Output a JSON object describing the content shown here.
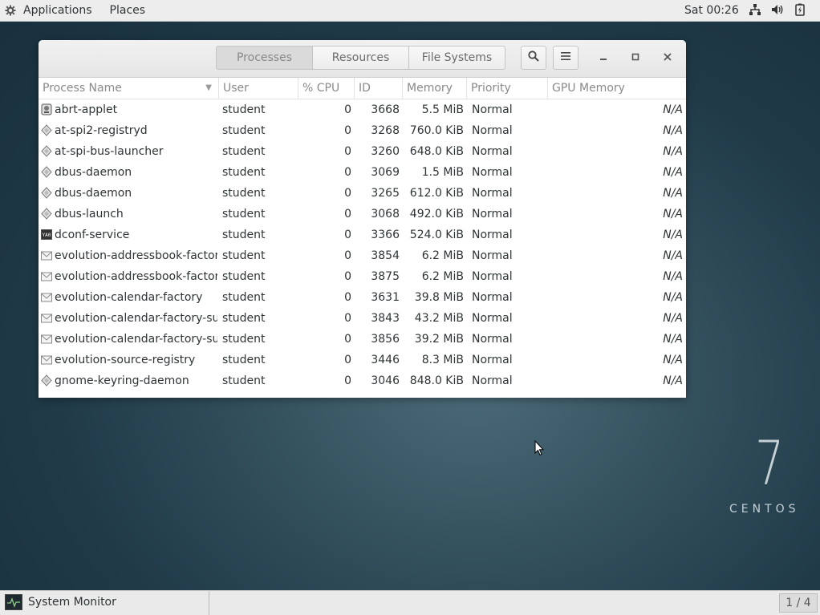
{
  "topbar": {
    "applications_label": "Applications",
    "places_label": "Places",
    "clock": "Sat 00:26"
  },
  "window": {
    "tabs": [
      "Processes",
      "Resources",
      "File Systems"
    ],
    "active_tab": "Processes",
    "columns": {
      "name": "Process Name",
      "user": "User",
      "cpu": "% CPU",
      "id": "ID",
      "memory": "Memory",
      "priority": "Priority",
      "gpu": "GPU Memory"
    },
    "rows": [
      {
        "icon": "applet-icon",
        "name": "abrt-applet",
        "user": "student",
        "cpu": "0",
        "id": "3668",
        "memory": "5.5 MiB",
        "priority": "Normal",
        "gpu": "N/A"
      },
      {
        "icon": "generic-process-icon",
        "name": "at-spi2-registryd",
        "user": "student",
        "cpu": "0",
        "id": "3268",
        "memory": "760.0 KiB",
        "priority": "Normal",
        "gpu": "N/A"
      },
      {
        "icon": "generic-process-icon",
        "name": "at-spi-bus-launcher",
        "user": "student",
        "cpu": "0",
        "id": "3260",
        "memory": "648.0 KiB",
        "priority": "Normal",
        "gpu": "N/A"
      },
      {
        "icon": "generic-process-icon",
        "name": "dbus-daemon",
        "user": "student",
        "cpu": "0",
        "id": "3069",
        "memory": "1.5 MiB",
        "priority": "Normal",
        "gpu": "N/A"
      },
      {
        "icon": "generic-process-icon",
        "name": "dbus-daemon",
        "user": "student",
        "cpu": "0",
        "id": "3265",
        "memory": "612.0 KiB",
        "priority": "Normal",
        "gpu": "N/A"
      },
      {
        "icon": "generic-process-icon",
        "name": "dbus-launch",
        "user": "student",
        "cpu": "0",
        "id": "3068",
        "memory": "492.0 KiB",
        "priority": "Normal",
        "gpu": "N/A"
      },
      {
        "icon": "terminal-icon",
        "name": "dconf-service",
        "user": "student",
        "cpu": "0",
        "id": "3366",
        "memory": "524.0 KiB",
        "priority": "Normal",
        "gpu": "N/A"
      },
      {
        "icon": "mail-icon",
        "name": "evolution-addressbook-factory",
        "user": "student",
        "cpu": "0",
        "id": "3854",
        "memory": "6.2 MiB",
        "priority": "Normal",
        "gpu": "N/A"
      },
      {
        "icon": "mail-icon",
        "name": "evolution-addressbook-factory-",
        "user": "student",
        "cpu": "0",
        "id": "3875",
        "memory": "6.2 MiB",
        "priority": "Normal",
        "gpu": "N/A"
      },
      {
        "icon": "mail-icon",
        "name": "evolution-calendar-factory",
        "user": "student",
        "cpu": "0",
        "id": "3631",
        "memory": "39.8 MiB",
        "priority": "Normal",
        "gpu": "N/A"
      },
      {
        "icon": "mail-icon",
        "name": "evolution-calendar-factory-subp",
        "user": "student",
        "cpu": "0",
        "id": "3843",
        "memory": "43.2 MiB",
        "priority": "Normal",
        "gpu": "N/A"
      },
      {
        "icon": "mail-icon",
        "name": "evolution-calendar-factory-subp",
        "user": "student",
        "cpu": "0",
        "id": "3856",
        "memory": "39.2 MiB",
        "priority": "Normal",
        "gpu": "N/A"
      },
      {
        "icon": "mail-icon",
        "name": "evolution-source-registry",
        "user": "student",
        "cpu": "0",
        "id": "3446",
        "memory": "8.3 MiB",
        "priority": "Normal",
        "gpu": "N/A"
      },
      {
        "icon": "generic-process-icon",
        "name": "gnome-keyring-daemon",
        "user": "student",
        "cpu": "0",
        "id": "3046",
        "memory": "848.0 KiB",
        "priority": "Normal",
        "gpu": "N/A"
      }
    ]
  },
  "desktop": {
    "version": "7",
    "brand": "CENTOS"
  },
  "taskbar": {
    "task_label": "System Monitor",
    "workspace": "1 / 4"
  }
}
